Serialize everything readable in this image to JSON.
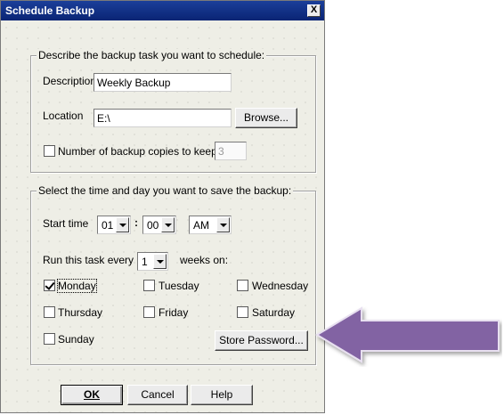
{
  "window": {
    "title": "Schedule Backup",
    "close_symbol": "X"
  },
  "task_group": {
    "legend": "Describe the backup task you want to schedule:",
    "description_label": "Description",
    "description_value": "Weekly Backup",
    "location_label": "Location",
    "location_value": "E:\\",
    "browse_button": "Browse...",
    "copies_label": "Number of backup copies to keep",
    "copies_checked": false,
    "copies_value": "3"
  },
  "time_group": {
    "legend": "Select the time and day you want to save the backup:",
    "start_label": "Start time",
    "hour": "01",
    "separator": ":",
    "minute": "00",
    "ampm": "AM",
    "run_label": "Run this task every",
    "weeks_value": "1",
    "weeks_label": "weeks on:",
    "days": [
      {
        "label": "Monday",
        "checked": true
      },
      {
        "label": "Tuesday",
        "checked": false
      },
      {
        "label": "Wednesday",
        "checked": false
      },
      {
        "label": "Thursday",
        "checked": false
      },
      {
        "label": "Friday",
        "checked": false
      },
      {
        "label": "Saturday",
        "checked": false
      },
      {
        "label": "Sunday",
        "checked": false
      }
    ],
    "store_password_button": "Store Password..."
  },
  "buttons": {
    "ok": "OK",
    "cancel": "Cancel",
    "help": "Help"
  },
  "annotation": {
    "arrow_color": "#8264a3",
    "arrow_icon": "left-arrow-icon"
  }
}
